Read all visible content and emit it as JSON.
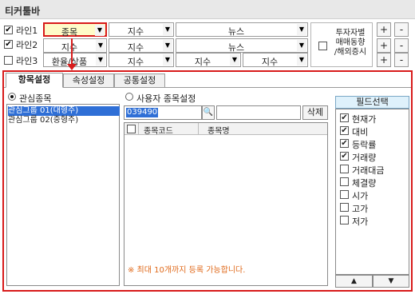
{
  "title": "티커툴바",
  "lines": [
    {
      "label": "라인1",
      "checked": "✔",
      "c1": "종목",
      "c2": "지수",
      "c3": "뉴스"
    },
    {
      "label": "라인2",
      "checked": "✔",
      "c1": "지수",
      "c2": "지수",
      "c3": "뉴스"
    },
    {
      "label": "라인3",
      "checked": "",
      "c1": "환율/상품",
      "c2": "지수",
      "c3a": "지수",
      "c3b": "지수"
    }
  ],
  "option_label": "투자자별\n매매동향\n/해외증시",
  "plus": "+",
  "minus": "-",
  "tabs": [
    "항목설정",
    "속성설정",
    "공통설정"
  ],
  "interest": {
    "label": "관심종목",
    "groups": [
      "관심그룹 01(대형주)",
      "관심그룹 02(중형주)"
    ]
  },
  "user": {
    "label": "사용자 종목설정",
    "code_value": "039490",
    "delete_label": "삭제",
    "col_code": "종목코드",
    "col_name": "종목명",
    "note": "※ 최대 10개까지 등록 가능합니다."
  },
  "fields": {
    "header": "필드선택",
    "items": [
      {
        "label": "현재가",
        "checked": "✔"
      },
      {
        "label": "대비",
        "checked": "✔"
      },
      {
        "label": "등락률",
        "checked": "✔"
      },
      {
        "label": "거래량",
        "checked": "✔"
      },
      {
        "label": "거래대금",
        "checked": ""
      },
      {
        "label": "체결량",
        "checked": ""
      },
      {
        "label": "시가",
        "checked": ""
      },
      {
        "label": "고가",
        "checked": ""
      },
      {
        "label": "저가",
        "checked": ""
      }
    ],
    "up": "▲",
    "down": "▼"
  },
  "arrow_glyph": "▼",
  "search_glyph": "🔍"
}
